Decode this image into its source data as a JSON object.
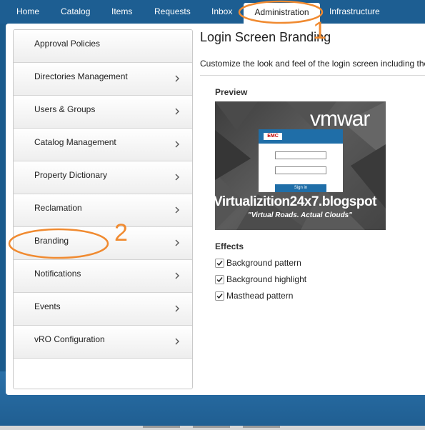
{
  "nav": {
    "tabs": [
      {
        "label": "Home"
      },
      {
        "label": "Catalog"
      },
      {
        "label": "Items"
      },
      {
        "label": "Requests"
      },
      {
        "label": "Inbox"
      },
      {
        "label": "Administration",
        "active": true
      },
      {
        "label": "Infrastructure"
      }
    ]
  },
  "sidebar": {
    "items": [
      {
        "label": "Approval Policies",
        "has_chevron": false
      },
      {
        "label": "Directories Management",
        "has_chevron": true
      },
      {
        "label": "Users & Groups",
        "has_chevron": true
      },
      {
        "label": "Catalog Management",
        "has_chevron": true
      },
      {
        "label": "Property Dictionary",
        "has_chevron": true
      },
      {
        "label": "Reclamation",
        "has_chevron": true
      },
      {
        "label": "Branding",
        "has_chevron": true
      },
      {
        "label": "Notifications",
        "has_chevron": true
      },
      {
        "label": "Events",
        "has_chevron": true
      },
      {
        "label": "vRO Configuration",
        "has_chevron": true
      }
    ]
  },
  "main": {
    "title": "Login Screen Branding",
    "description": "Customize the look and feel of the login screen including the",
    "preview_label": "Preview",
    "preview": {
      "brand": "vmwar",
      "logo": "EMC",
      "button_text": "Sign in",
      "watermark": "Virtualizition24x7.blogspot",
      "tagline": "\"Virtual Roads. Actual Clouds\""
    },
    "effects_label": "Effects",
    "effects": [
      {
        "label": "Background pattern",
        "checked": true
      },
      {
        "label": "Background highlight",
        "checked": true
      },
      {
        "label": "Masthead pattern",
        "checked": true
      }
    ]
  },
  "annotations": {
    "num1": "1",
    "num2": "2",
    "color": "#f08a30"
  },
  "colors": {
    "nav_bg": "#1d5e92",
    "page_bg": "#1a5a8c",
    "accent": "#1f6ea8"
  }
}
